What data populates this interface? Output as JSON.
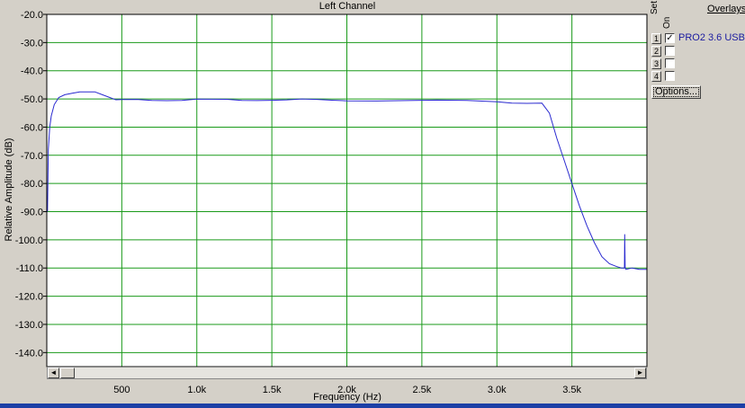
{
  "chart_data": {
    "type": "line",
    "title": "Left Channel",
    "xlabel": "Frequency (Hz)",
    "ylabel": "Relative Amplitude (dB)",
    "xlim": [
      0,
      4000
    ],
    "ylim": [
      -145,
      -20
    ],
    "grid": true,
    "x_ticks": [
      500,
      1000,
      1500,
      2000,
      2500,
      3000,
      3500
    ],
    "x_tick_labels": [
      "500",
      "1.0k",
      "1.5k",
      "2.0k",
      "2.5k",
      "3.0k",
      "3.5k"
    ],
    "y_ticks": [
      -20,
      -30,
      -40,
      -50,
      -60,
      -70,
      -80,
      -90,
      -100,
      -110,
      -120,
      -130,
      -140
    ],
    "y_tick_labels": [
      "-20.0",
      "-30.0",
      "-40.0",
      "-50.0",
      "-60.0",
      "-70.0",
      "-80.0",
      "-90.0",
      "-100.0",
      "-110.0",
      "-120.0",
      "-130.0",
      "-140.0"
    ],
    "series": [
      {
        "name": "PRO2 3.6 USB",
        "color": "#2a2ad0",
        "x": [
          5,
          10,
          20,
          30,
          50,
          80,
          120,
          170,
          220,
          270,
          320,
          370,
          420,
          460,
          500,
          600,
          700,
          800,
          900,
          1000,
          1100,
          1200,
          1300,
          1400,
          1500,
          1600,
          1700,
          1800,
          1900,
          2000,
          2200,
          2400,
          2600,
          2800,
          3000,
          3100,
          3200,
          3300,
          3350,
          3400,
          3450,
          3500,
          3550,
          3600,
          3650,
          3700,
          3750,
          3800,
          3830,
          3850,
          3852,
          3855,
          3857,
          3860,
          3900,
          3950,
          4000
        ],
        "y": [
          -90,
          -68,
          -60,
          -56,
          -52,
          -49.5,
          -48.5,
          -48,
          -47.5,
          -47.5,
          -47.5,
          -48.5,
          -49.5,
          -50.3,
          -50.5,
          -50.3,
          -50.4,
          -50.3,
          -50.4,
          -50.2,
          -50.4,
          -50.3,
          -50.4,
          -50.3,
          -50.3,
          -50.4,
          -50.3,
          -50.4,
          -50.4,
          -50.4,
          -50.5,
          -50.6,
          -50.7,
          -50.8,
          -51.0,
          -51.2,
          -51.3,
          -51.5,
          -55,
          -64,
          -72,
          -80,
          -88,
          -95,
          -101,
          -106,
          -108.5,
          -109.5,
          -110,
          -110,
          -98,
          -110,
          -110,
          -110.5,
          -110,
          -110.5,
          -110.5
        ]
      }
    ]
  },
  "overlays": {
    "title": "Overlays",
    "set_header": "Set",
    "on_header": "On",
    "items": [
      {
        "num": "1",
        "checked": true,
        "check_mark": "✓",
        "name": "PRO2 3.6 USB"
      },
      {
        "num": "2",
        "checked": false,
        "check_mark": "",
        "name": ""
      },
      {
        "num": "3",
        "checked": false,
        "check_mark": "",
        "name": ""
      },
      {
        "num": "4",
        "checked": false,
        "check_mark": "",
        "name": ""
      }
    ],
    "options_label": "Options..."
  },
  "scrollbar": {
    "left_arrow": "◄",
    "right_arrow": "►"
  }
}
